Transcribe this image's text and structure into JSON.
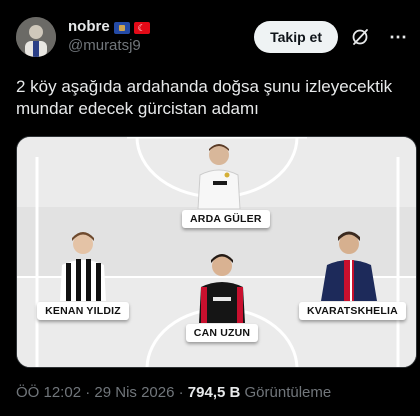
{
  "author": {
    "display_name": "nobre",
    "handle": "@muratsj9",
    "flags": [
      "kosovo-flag",
      "turkey-flag"
    ]
  },
  "header": {
    "follow_label": "Takip et",
    "grok_icon": "grok-icon",
    "more_icon": "more-icon"
  },
  "tweet": {
    "text": "2 köy aşağıda ardahanda doğsa şunu izleyecektik mundar edecek gürcistan adamı"
  },
  "media": {
    "players": [
      {
        "name": "ARDA GÜLER",
        "kit": "white"
      },
      {
        "name": "KENAN YILDIZ",
        "kit": "black-white-stripes"
      },
      {
        "name": "CAN UZUN",
        "kit": "black-red"
      },
      {
        "name": "KVARATSKHELIA",
        "kit": "navy"
      }
    ]
  },
  "meta": {
    "time": "ÖÖ 12:02",
    "separator": " · ",
    "date": "29 Nis 2026",
    "views_count": "794,5 B",
    "views_label": "Görüntüleme"
  }
}
